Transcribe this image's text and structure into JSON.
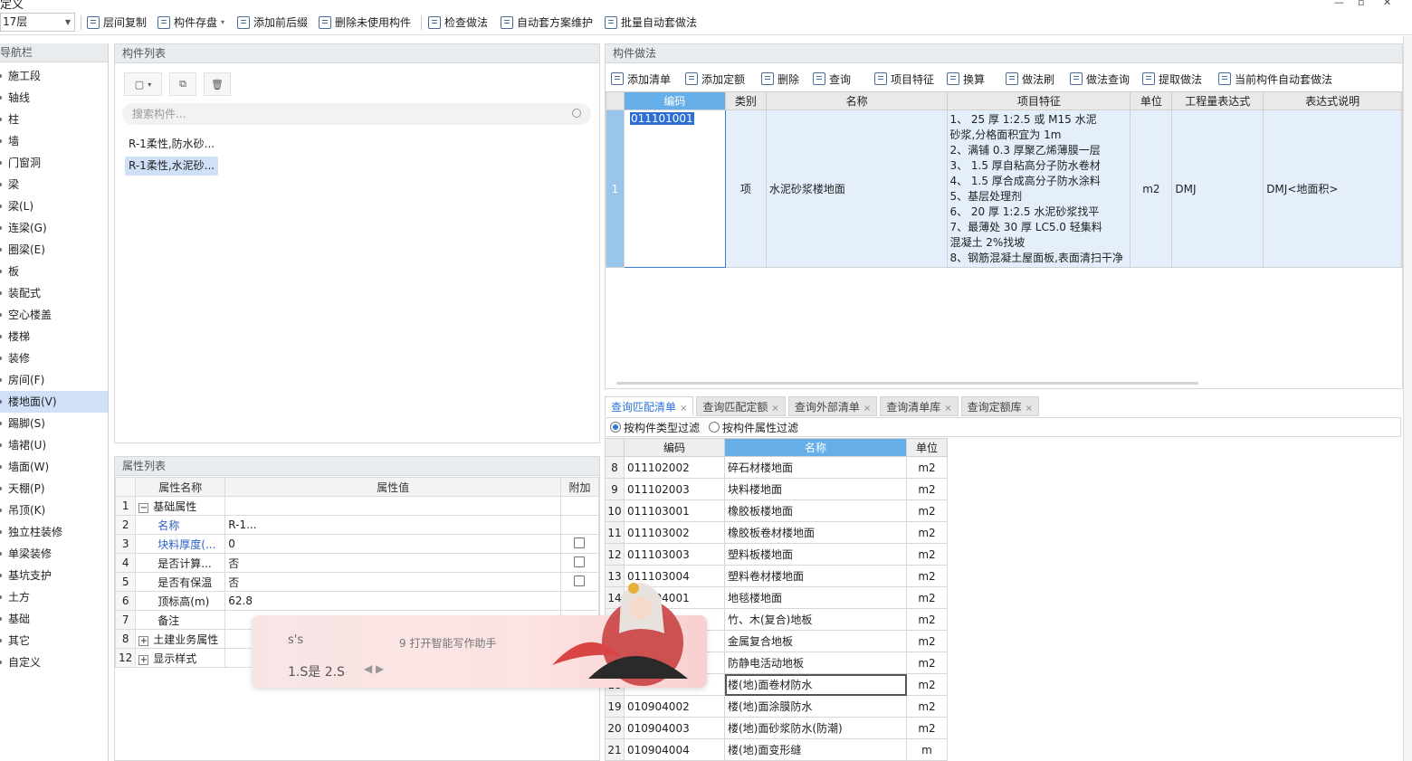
{
  "app": {
    "title": "定义"
  },
  "toolbar": {
    "floor": "17层",
    "items": [
      {
        "label": "层间复制",
        "icon": "copy-icon"
      },
      {
        "label": "构件存盘",
        "icon": "save-icon"
      },
      {
        "label": "添加前后缀",
        "icon": "prefix-icon"
      },
      {
        "label": "删除未使用构件",
        "icon": "delete-unused-icon"
      },
      {
        "label": "检查做法",
        "icon": "check-icon"
      },
      {
        "label": "自动套方案维护",
        "icon": "maintain-icon"
      },
      {
        "label": "批量自动套做法",
        "icon": "batch-icon"
      }
    ]
  },
  "nav": {
    "title": "导航栏",
    "items": [
      "施工段",
      "轴线",
      "柱",
      "墙",
      "门窗洞",
      "梁",
      "梁(L)",
      "连梁(G)",
      "圈梁(E)",
      "板",
      "装配式",
      "空心楼盖",
      "楼梯",
      "装修",
      "房间(F)",
      "楼地面(V)",
      "踢脚(S)",
      "墙裙(U)",
      "墙面(W)",
      "天棚(P)",
      "吊顶(K)",
      "独立柱装修",
      "单梁装修",
      "基坑支护",
      "土方",
      "基础",
      "其它",
      "自定义"
    ],
    "selected": "楼地面(V)"
  },
  "components": {
    "title": "构件列表",
    "search_placeholder": "搜索构件...",
    "items": [
      "R-1柔性,防水砂...",
      "R-1柔性,水泥砂..."
    ]
  },
  "properties": {
    "title": "属性列表",
    "headers": [
      "属性名称",
      "属性值",
      "附加"
    ],
    "rows": [
      {
        "n": "1",
        "name": "基础属性",
        "value": "",
        "group": true,
        "sign": "−"
      },
      {
        "n": "2",
        "name": "名称",
        "value": "R-1...",
        "blue": true
      },
      {
        "n": "3",
        "name": "块料厚度(...",
        "value": "0",
        "blue": true,
        "chk": true
      },
      {
        "n": "4",
        "name": "是否计算...",
        "value": "否",
        "chk": true
      },
      {
        "n": "5",
        "name": "是否有保温",
        "value": "否",
        "chk": true
      },
      {
        "n": "6",
        "name": "顶标高(m)",
        "value": "62.8"
      },
      {
        "n": "7",
        "name": "备注",
        "value": ""
      },
      {
        "n": "8",
        "name": "土建业务属性",
        "value": "",
        "group": true,
        "sign": "+"
      },
      {
        "n": "12",
        "name": "显示样式",
        "value": "",
        "group": true,
        "sign": "+"
      }
    ]
  },
  "method": {
    "title": "构件做法",
    "tools": [
      "添加清单",
      "添加定额",
      "删除",
      "查询",
      "项目特征",
      "换算",
      "做法刷",
      "做法查询",
      "提取做法",
      "当前构件自动套做法"
    ],
    "headers": [
      "编码",
      "类别",
      "名称",
      "项目特征",
      "单位",
      "工程量表达式",
      "表达式说明"
    ],
    "row": {
      "num": "1",
      "code": "011101001",
      "type": "项",
      "name": "水泥砂浆楼地面",
      "features": [
        "1、  25 厚  1:2.5  或  M15  水泥",
        "砂浆,分格面积宜为  1m",
        "2、满铺  0.3 厚聚乙烯薄膜一层",
        "3、  1.5 厚自粘高分子防水卷材",
        "4、  1.5  厚合成高分子防水涂料",
        "5、基层处理剂",
        "6、  20 厚    1:2.5  水泥砂浆找平",
        "7、最薄处  30 厚    LC5.0  轻集料",
        "混凝土    2%找坡",
        "8、钢筋混凝土屋面板,表面清扫干净"
      ],
      "unit": "m2",
      "expr": "DMJ",
      "expr_desc": "DMJ<地面积>"
    }
  },
  "query": {
    "tabs": [
      "查询匹配清单",
      "查询匹配定额",
      "查询外部清单",
      "查询清单库",
      "查询定额库"
    ],
    "filter_type": "按构件类型过滤",
    "filter_attr": "按构件属性过滤",
    "headers": [
      "编码",
      "名称",
      "单位"
    ],
    "rows": [
      {
        "n": "8",
        "code": "011102002",
        "name": "碎石材楼地面",
        "unit": "m2"
      },
      {
        "n": "9",
        "code": "011102003",
        "name": "块料楼地面",
        "unit": "m2"
      },
      {
        "n": "10",
        "code": "011103001",
        "name": "橡胶板楼地面",
        "unit": "m2"
      },
      {
        "n": "11",
        "code": "011103002",
        "name": "橡胶板卷材楼地面",
        "unit": "m2"
      },
      {
        "n": "12",
        "code": "011103003",
        "name": "塑料板楼地面",
        "unit": "m2"
      },
      {
        "n": "13",
        "code": "011103004",
        "name": "塑料卷材楼地面",
        "unit": "m2"
      },
      {
        "n": "14",
        "code": "011104001",
        "name": "地毯楼地面",
        "unit": "m2"
      },
      {
        "n": "15",
        "code": "",
        "name": "竹、木(复合)地板",
        "unit": "m2"
      },
      {
        "n": "16",
        "code": "",
        "name": "金属复合地板",
        "unit": "m2"
      },
      {
        "n": "17",
        "code": "",
        "name": "防静电活动地板",
        "unit": "m2"
      },
      {
        "n": "18",
        "code": "",
        "name": "楼(地)面卷材防水",
        "unit": "m2",
        "focus": true
      },
      {
        "n": "19",
        "code": "010904002",
        "name": "楼(地)面涂膜防水",
        "unit": "m2"
      },
      {
        "n": "20",
        "code": "010904003",
        "name": "楼(地)面砂浆防水(防潮)",
        "unit": "m2"
      },
      {
        "n": "21",
        "code": "010904004",
        "name": "楼(地)面变形缝",
        "unit": "m"
      }
    ]
  },
  "ime": {
    "composition": "s's",
    "assistant": "9 打开智能写作助手",
    "candidates": "1.S是    2.S",
    "pager": "◀ ▶"
  }
}
